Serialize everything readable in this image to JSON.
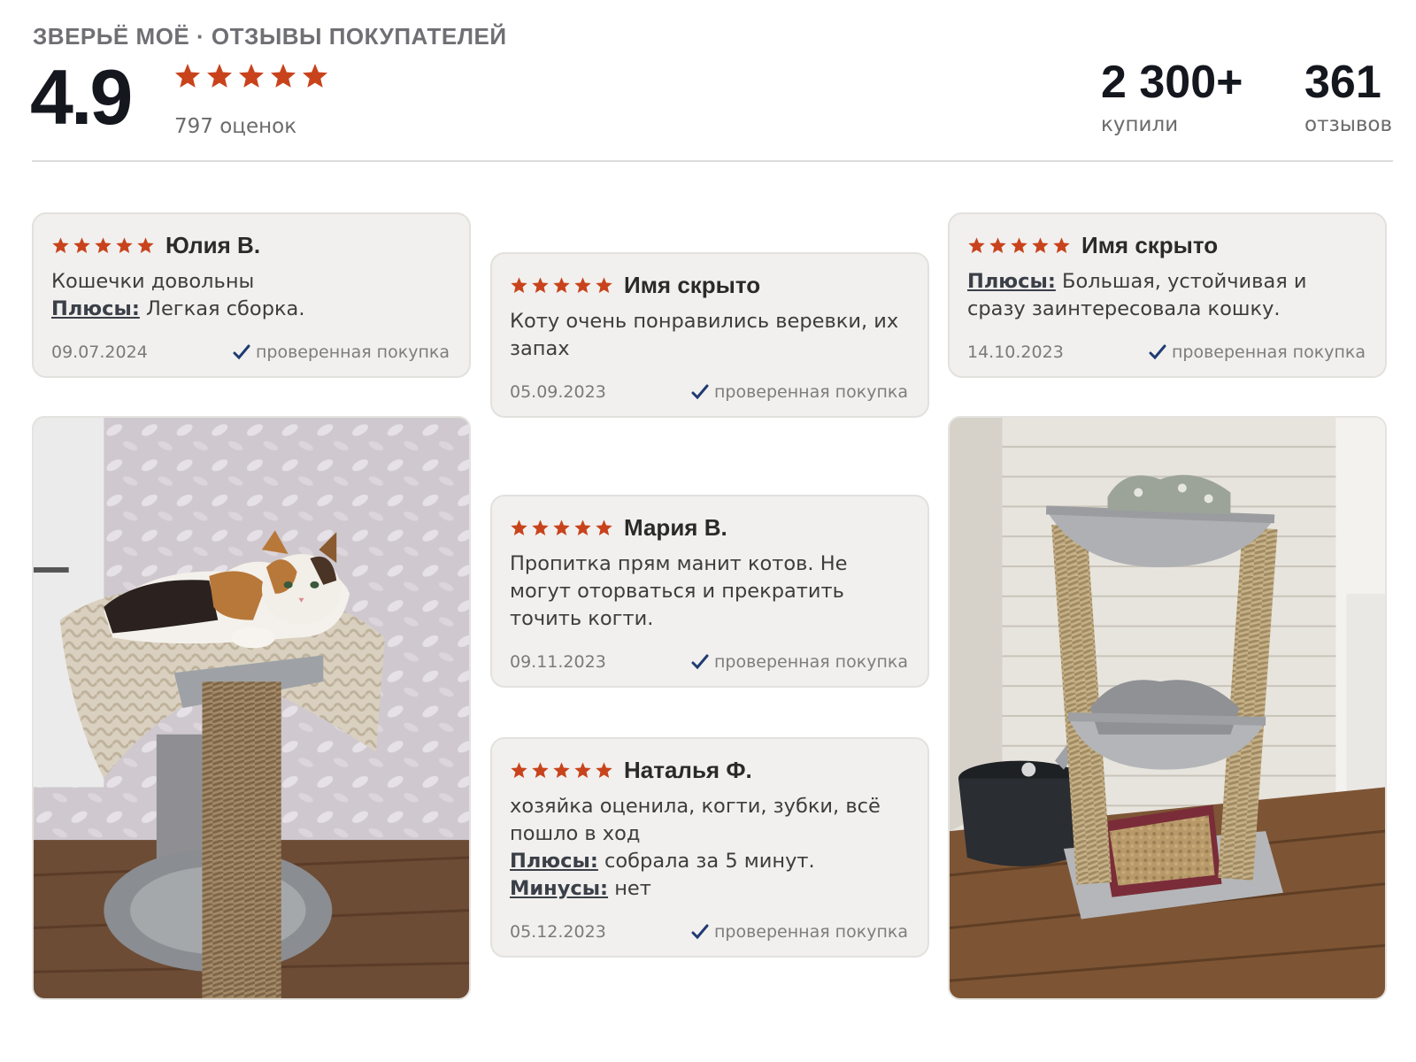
{
  "header": {
    "brand": "ЗВЕРЬЁ МОЁ · ОТЗЫВЫ ПОКУПАТЕЛЕЙ",
    "rating": "4.9",
    "rating_stars": 5,
    "ratings_count": "797 оценок",
    "stats": [
      {
        "value": "2 300+",
        "label": "купили"
      },
      {
        "value": "361",
        "label": "отзывов"
      }
    ]
  },
  "colors": {
    "star": "#c8431c",
    "check": "#1f3b73",
    "card_bg": "#f1f0ee"
  },
  "reviews": [
    {
      "stars": 5,
      "author": "Юлия В.",
      "text": "Кошечки довольны",
      "pros_label": "Плюсы:",
      "pros": " Легкая сборка.",
      "date": "09.07.2024",
      "verified": "проверенная покупка"
    },
    {
      "stars": 5,
      "author": "Имя скрыто",
      "text": "Коту очень понравились веревки, их запах",
      "date": "05.09.2023",
      "verified": "проверенная покупка"
    },
    {
      "stars": 5,
      "author": "Имя скрыто",
      "pros_label": "Плюсы:",
      "pros": " Большая, устойчивая и сразу заинтересовала кошку.",
      "date": "14.10.2023",
      "verified": "проверенная покупка"
    },
    {
      "stars": 5,
      "author": "Мария В.",
      "text": "Пропитка прям манит котов. Не могут оторваться и прекратить точить когти.",
      "date": "09.11.2023",
      "verified": "проверенная покупка"
    },
    {
      "stars": 5,
      "author": "Наталья Ф.",
      "text": "хозяйка оценила, когти, зубки, всё пошло в ход",
      "pros_label": "Плюсы:",
      "pros": " собрала за 5 минут.",
      "cons_label": "Минусы:",
      "cons": " нет",
      "date": "05.12.2023",
      "verified": "проверенная покупка"
    }
  ],
  "photos": [
    {
      "icon": "cat-on-scratching-post-photo"
    },
    {
      "icon": "cat-tree-with-hammocks-photo"
    }
  ]
}
